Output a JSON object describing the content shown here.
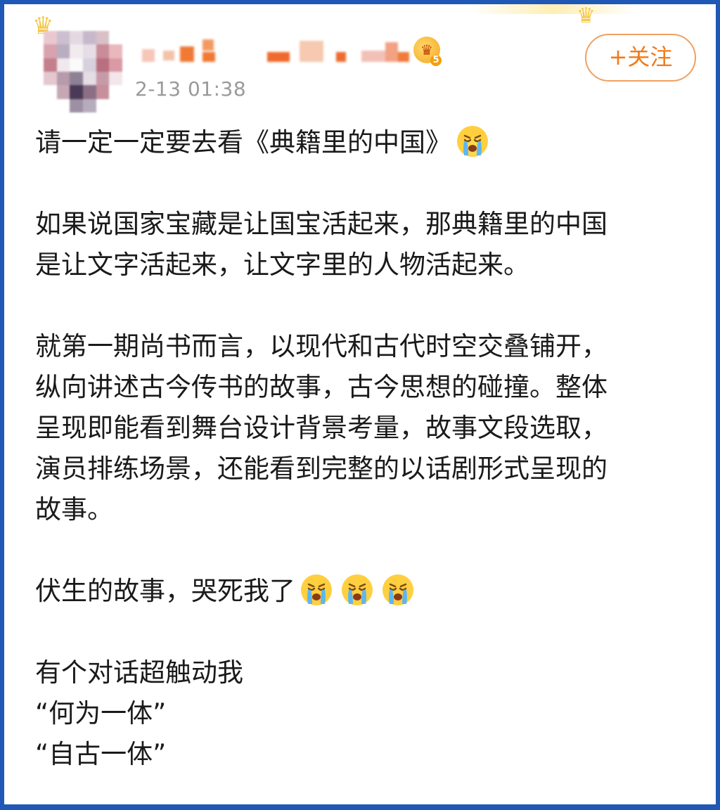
{
  "header": {
    "timestamp": "2-13 01:38",
    "follow_label": "+关注",
    "vip_level": "5"
  },
  "post": {
    "line1": "请一定一定要去看《典籍里的中国》",
    "para2": [
      "如果说国家宝藏是让国宝活起来，那典籍里的中国",
      "是让文字活起来，让文字里的人物活起来。"
    ],
    "para3": [
      "就第一期尚书而言，以现代和古代时空交叠铺开，",
      "纵向讲述古今传书的故事，古今思想的碰撞。整体",
      "呈现即能看到舞台设计背景考量，故事文段选取，",
      "演员排练场景，还能看到完整的以话剧形式呈现的",
      "故事。"
    ],
    "line4": "伏生的故事，哭死我了",
    "para5": [
      "有个对话超触动我",
      "“何为一体”",
      "“自古一体”"
    ]
  },
  "icons": {
    "crying_emoji": "crying-face-icon",
    "crown": "crown-icon",
    "vip": "vip-crown-badge-icon"
  },
  "colors": {
    "frame": "#1f58b5",
    "follow": "#f07b1a",
    "timestamp": "#9a9a9a"
  }
}
